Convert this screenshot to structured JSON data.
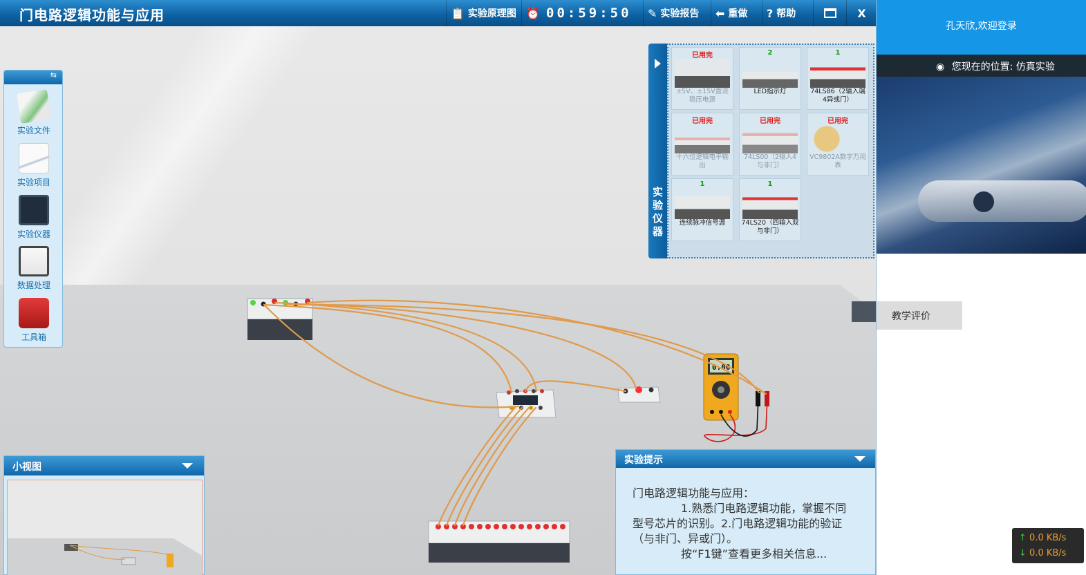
{
  "window": {
    "title": "门电路逻辑功能与应用",
    "toolbar": {
      "principle_label": "实验原理图",
      "timer": "00:59:50",
      "report_label": "实验报告",
      "redo_label": "重做",
      "help_label": "帮助",
      "close_label": "X"
    }
  },
  "left_tools": [
    {
      "label": "实验文件",
      "icon": "document-icon"
    },
    {
      "label": "实验项目",
      "icon": "project-icon"
    },
    {
      "label": "实验仪器",
      "icon": "monitor-icon"
    },
    {
      "label": "数据处理",
      "icon": "chart-icon"
    },
    {
      "label": "工具箱",
      "icon": "toolbox-icon"
    }
  ],
  "instrument_panel": {
    "title": "实验仪器",
    "items": [
      {
        "count": "已用完",
        "name": "±5V、±15V直流稳压电源",
        "used": true
      },
      {
        "count": "2",
        "name": "LED指示灯",
        "used": false
      },
      {
        "count": "1",
        "name": "74LS86（2输入端4异或门）",
        "used": false
      },
      {
        "count": "已用完",
        "name": "十六位逻辑电平输出",
        "used": true
      },
      {
        "count": "已用完",
        "name": "74LS00（2输入4与非门）",
        "used": true
      },
      {
        "count": "已用完",
        "name": "VC9802A数字万用表",
        "used": true
      },
      {
        "count": "1",
        "name": "连续脉冲信号源",
        "used": false
      },
      {
        "count": "1",
        "name": "74LS20（四输入双与非门）",
        "used": false
      }
    ]
  },
  "minimap": {
    "title": "小视图"
  },
  "hint": {
    "title": "实验提示",
    "line1": "门电路逻辑功能与应用：",
    "line2": "1.熟悉门电路逻辑功能，掌握不同型号芯片的识别。2.门电路逻辑功能的验证（与非门、异或门）。",
    "line3": "按“F1键”查看更多相关信息..."
  },
  "multimeter": {
    "display": "0.00"
  },
  "right": {
    "welcome": "孔天欣,欢迎登录",
    "location": "您现在的位置: 仿真实验",
    "eval_tab": "教学评价"
  },
  "speed": {
    "up": "0.0 KB/s",
    "down": "0.0 KB/s"
  },
  "colors": {
    "accent": "#0d63a5",
    "wire": "#e09a4a",
    "used": "#e01b1b",
    "available": "#1a9b1a"
  }
}
